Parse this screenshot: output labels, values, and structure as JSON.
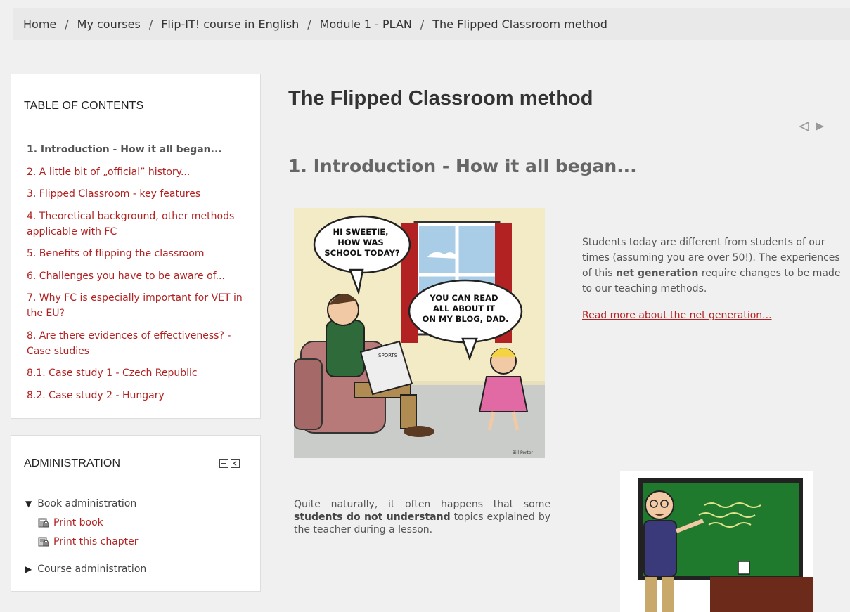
{
  "breadcrumb": {
    "items": [
      "Home",
      "My courses",
      "Flip-IT! course in English",
      "Module 1 - PLAN",
      "The Flipped Classroom method"
    ]
  },
  "toc": {
    "title": "TABLE OF CONTENTS",
    "items": [
      "1. Introduction - How it all began...",
      "2. A little bit of „official” history...",
      "3. Flipped Classroom - key features",
      "4. Theoretical background, other methods applicable with FC",
      "5. Benefits of flipping the classroom",
      "6. Challenges you have to be aware of...",
      "7. Why FC is especially important for VET in the EU?",
      "8. Are there evidences of effectiveness? - Case studies",
      "8.1. Case study 1 - Czech Republic",
      "8.2. Case study 2 - Hungary"
    ]
  },
  "admin": {
    "title": "ADMINISTRATION",
    "book_admin": "Book administration",
    "print_book": "Print book",
    "print_chapter": "Print this chapter",
    "course_admin": "Course administration"
  },
  "main": {
    "page_title": "The Flipped Classroom method",
    "chapter_title": "1. Introduction - How it all began...",
    "para1_a": "Students today are different from students of our times (assuming you are over 50!).  The experiences of this ",
    "para1_b": "net generation",
    "para1_c": " require changes to be made to our teaching methods.",
    "read_more": "Read more about the net generation...",
    "para2_a": "Quite naturally, it often happens that some ",
    "para2_b": "students do not understand",
    "para2_c": " topics explained by the teacher during a lesson."
  },
  "cartoon": {
    "bubble1": [
      "HI SWEETIE,",
      "HOW WAS",
      "SCHOOL TODAY?"
    ],
    "bubble2": [
      "YOU CAN READ",
      "ALL ABOUT IT",
      "ON MY BLOG, DAD."
    ],
    "newspaper": "SPORTS",
    "signature": "Bill Porter"
  },
  "colors": {
    "link": "#b22222",
    "background": "#f0f0f0",
    "chalkboard": "#1f7a2e"
  },
  "icons": [
    "collapse-icon",
    "dock-icon",
    "print-book-icon",
    "print-chapter-icon",
    "prev-arrow-icon",
    "next-arrow-icon"
  ]
}
